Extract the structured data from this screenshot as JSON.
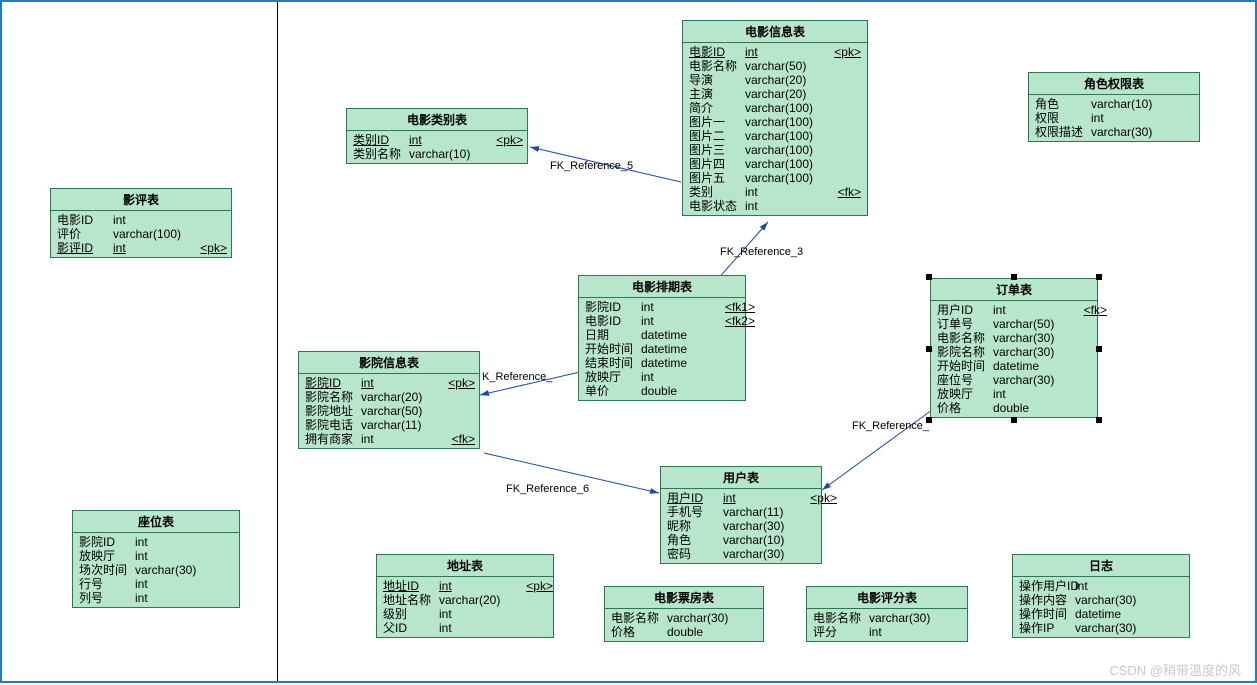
{
  "watermark": "CSDN @稍带温度的风",
  "fk_labels": {
    "ref5": "FK_Reference_5",
    "ref3": "FK_Reference_3",
    "refK": "K_Reference_",
    "ref6": "FK_Reference_6",
    "refOrder": "FK_Reference_"
  },
  "entities": {
    "movieCategory": {
      "title": "电影类别表",
      "rows": [
        {
          "name": "类别ID",
          "type": "int",
          "key": "<pk>",
          "pk": true
        },
        {
          "name": "类别名称",
          "type": "varchar(10)",
          "key": ""
        }
      ]
    },
    "review": {
      "title": "影评表",
      "rows": [
        {
          "name": "电影ID",
          "type": "int",
          "key": ""
        },
        {
          "name": "评价",
          "type": "varchar(100)",
          "key": ""
        },
        {
          "name": "影评ID",
          "type": "int",
          "key": "<pk>",
          "pk": true
        }
      ]
    },
    "movieInfo": {
      "title": "电影信息表",
      "rows": [
        {
          "name": "电影ID",
          "type": "int",
          "key": "<pk>",
          "pk": true
        },
        {
          "name": "电影名称",
          "type": "varchar(50)",
          "key": ""
        },
        {
          "name": "导演",
          "type": "varchar(20)",
          "key": ""
        },
        {
          "name": "主演",
          "type": "varchar(20)",
          "key": ""
        },
        {
          "name": "简介",
          "type": "varchar(100)",
          "key": ""
        },
        {
          "name": "图片一",
          "type": "varchar(100)",
          "key": ""
        },
        {
          "name": "图片二",
          "type": "varchar(100)",
          "key": ""
        },
        {
          "name": "图片三",
          "type": "varchar(100)",
          "key": ""
        },
        {
          "name": "图片四",
          "type": "varchar(100)",
          "key": ""
        },
        {
          "name": "图片五",
          "type": "varchar(100)",
          "key": ""
        },
        {
          "name": "类别",
          "type": "int",
          "key": "<fk>"
        },
        {
          "name": "电影状态",
          "type": "int",
          "key": ""
        }
      ]
    },
    "rolePerm": {
      "title": "角色权限表",
      "rows": [
        {
          "name": "角色",
          "type": "varchar(10)",
          "key": ""
        },
        {
          "name": "权限",
          "type": "int",
          "key": ""
        },
        {
          "name": "权限描述",
          "type": "varchar(30)",
          "key": ""
        }
      ]
    },
    "schedule": {
      "title": "电影排期表",
      "rows": [
        {
          "name": "影院ID",
          "type": "int",
          "key": "<fk1>"
        },
        {
          "name": "电影ID",
          "type": "int",
          "key": "<fk2>"
        },
        {
          "name": "日期",
          "type": "datetime",
          "key": ""
        },
        {
          "name": "开始时间",
          "type": "datetime",
          "key": ""
        },
        {
          "name": "结束时间",
          "type": "datetime",
          "key": ""
        },
        {
          "name": "放映厅",
          "type": "int",
          "key": ""
        },
        {
          "name": "单价",
          "type": "double",
          "key": ""
        }
      ]
    },
    "order": {
      "title": "订单表",
      "rows": [
        {
          "name": "用户ID",
          "type": "int",
          "key": "<fk>"
        },
        {
          "name": "订单号",
          "type": "varchar(50)",
          "key": ""
        },
        {
          "name": "电影名称",
          "type": "varchar(30)",
          "key": ""
        },
        {
          "name": "影院名称",
          "type": "varchar(30)",
          "key": ""
        },
        {
          "name": "开始时间",
          "type": "datetime",
          "key": ""
        },
        {
          "name": "座位号",
          "type": "varchar(30)",
          "key": ""
        },
        {
          "name": "放映厅",
          "type": "int",
          "key": ""
        },
        {
          "name": "价格",
          "type": "double",
          "key": ""
        }
      ]
    },
    "cinema": {
      "title": "影院信息表",
      "rows": [
        {
          "name": "影院ID",
          "type": "int",
          "key": "<pk>",
          "pk": true
        },
        {
          "name": "影院名称",
          "type": "varchar(20)",
          "key": ""
        },
        {
          "name": "影院地址",
          "type": "varchar(50)",
          "key": ""
        },
        {
          "name": "影院电话",
          "type": "varchar(11)",
          "key": ""
        },
        {
          "name": "拥有商家",
          "type": "int",
          "key": "<fk>"
        }
      ]
    },
    "user": {
      "title": "用户表",
      "rows": [
        {
          "name": "用户ID",
          "type": "int",
          "key": "<pk>",
          "pk": true
        },
        {
          "name": "手机号",
          "type": "varchar(11)",
          "key": ""
        },
        {
          "name": "昵称",
          "type": "varchar(30)",
          "key": ""
        },
        {
          "name": "角色",
          "type": "varchar(10)",
          "key": ""
        },
        {
          "name": "密码",
          "type": "varchar(30)",
          "key": ""
        }
      ]
    },
    "seat": {
      "title": "座位表",
      "rows": [
        {
          "name": "影院ID",
          "type": "int",
          "key": ""
        },
        {
          "name": "放映厅",
          "type": "int",
          "key": ""
        },
        {
          "name": "场次时间",
          "type": "varchar(30)",
          "key": ""
        },
        {
          "name": "行号",
          "type": "int",
          "key": ""
        },
        {
          "name": "列号",
          "type": "int",
          "key": ""
        }
      ]
    },
    "address": {
      "title": "地址表",
      "rows": [
        {
          "name": "地址ID",
          "type": "int",
          "key": "<pk>",
          "pk": true
        },
        {
          "name": "地址名称",
          "type": "varchar(20)",
          "key": ""
        },
        {
          "name": "级别",
          "type": "int",
          "key": ""
        },
        {
          "name": "父ID",
          "type": "int",
          "key": ""
        }
      ]
    },
    "boxOffice": {
      "title": "电影票房表",
      "rows": [
        {
          "name": "电影名称",
          "type": "varchar(30)",
          "key": ""
        },
        {
          "name": "价格",
          "type": "double",
          "key": ""
        }
      ]
    },
    "rating": {
      "title": "电影评分表",
      "rows": [
        {
          "name": "电影名称",
          "type": "varchar(30)",
          "key": ""
        },
        {
          "name": "评分",
          "type": "int",
          "key": ""
        }
      ]
    },
    "log": {
      "title": "日志",
      "rows": [
        {
          "name": "操作用户ID",
          "type": "int",
          "key": ""
        },
        {
          "name": "操作内容",
          "type": "varchar(30)",
          "key": ""
        },
        {
          "name": "操作时间",
          "type": "datetime",
          "key": ""
        },
        {
          "name": "操作IP",
          "type": "varchar(30)",
          "key": ""
        }
      ]
    }
  }
}
